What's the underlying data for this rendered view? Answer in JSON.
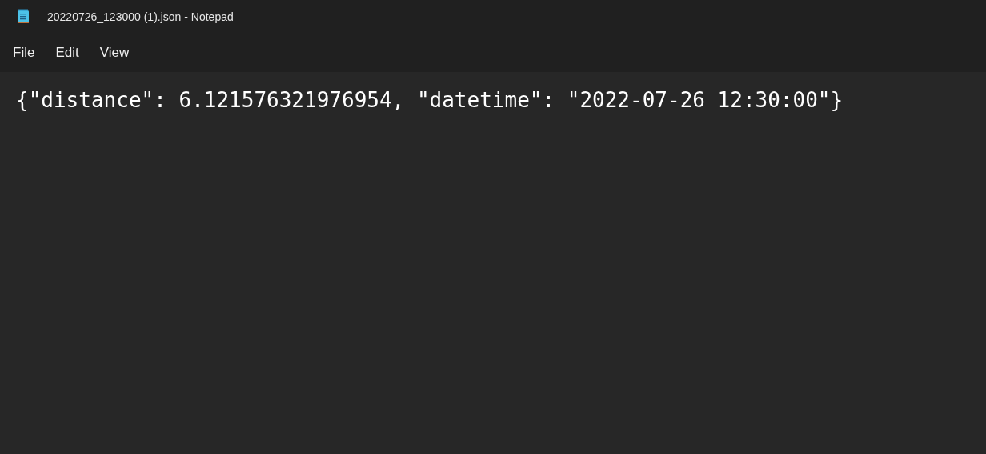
{
  "window": {
    "title": "20220726_123000 (1).json - Notepad"
  },
  "menu": [
    "File",
    "Edit",
    "View"
  ],
  "document": {
    "lines": [
      "{\"distance\": 6.121576321976954, \"datetime\": \"2022-07-26 12:30:00\"}"
    ]
  }
}
